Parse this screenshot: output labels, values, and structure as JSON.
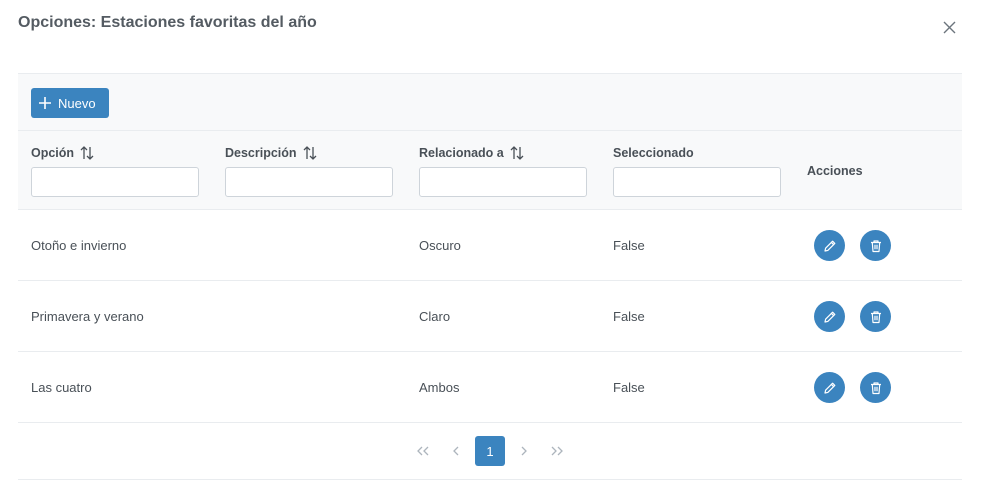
{
  "dialog": {
    "title": "Opciones: Estaciones favoritas del año",
    "close_icon": "close-icon"
  },
  "toolbar": {
    "new_label": "Nuevo",
    "new_icon": "plus-icon"
  },
  "columns": [
    {
      "label": "Opción",
      "sortable": true
    },
    {
      "label": "Descripción",
      "sortable": true
    },
    {
      "label": "Relacionado a",
      "sortable": true
    },
    {
      "label": "Seleccionado",
      "sortable": false
    },
    {
      "label": "Acciones",
      "sortable": false
    }
  ],
  "filters": [
    "",
    "",
    "",
    ""
  ],
  "rows": [
    {
      "opcion": "Otoño e invierno",
      "descripcion": "",
      "relacionado": "Oscuro",
      "seleccionado": "False"
    },
    {
      "opcion": "Primavera y verano",
      "descripcion": "",
      "relacionado": "Claro",
      "seleccionado": "False"
    },
    {
      "opcion": "Las cuatro",
      "descripcion": "",
      "relacionado": "Ambos",
      "seleccionado": "False"
    }
  ],
  "row_actions": {
    "edit_icon": "pencil-icon",
    "delete_icon": "trash-icon"
  },
  "pagination": {
    "current_page": "1"
  },
  "colors": {
    "primary": "#3b84bf",
    "header_bg": "#f8f9fa",
    "border": "#e9ecef"
  }
}
